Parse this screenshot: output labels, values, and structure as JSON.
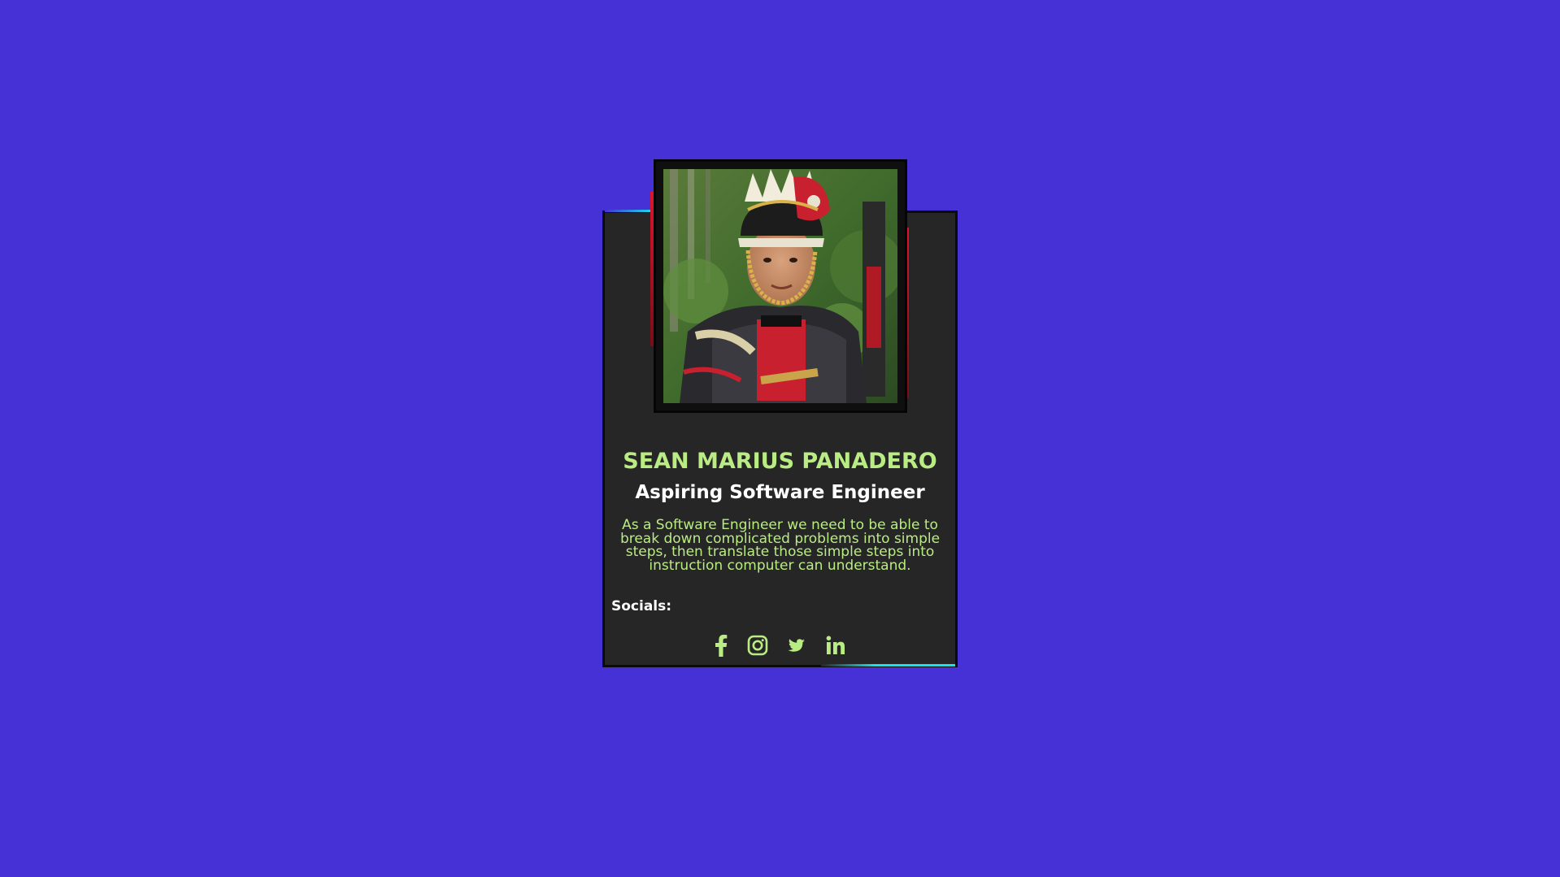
{
  "profile": {
    "name": "SEAN MARIUS PANADERO",
    "role": "Aspiring Software Engineer",
    "description": "As a Software Engineer we need to be able to break down complicated problems into simple steps, then translate those simple steps into instruction computer can understand.",
    "socials_label": "Socials:"
  },
  "socials": [
    {
      "icon": "facebook-icon"
    },
    {
      "icon": "instagram-icon"
    },
    {
      "icon": "twitter-icon"
    },
    {
      "icon": "linkedin-icon"
    }
  ],
  "colors": {
    "background": "#4631d6",
    "card": "#262626",
    "accent_green": "#b9ec82",
    "accent_cyan": "#17e3ee",
    "accent_red": "#e0142a"
  }
}
